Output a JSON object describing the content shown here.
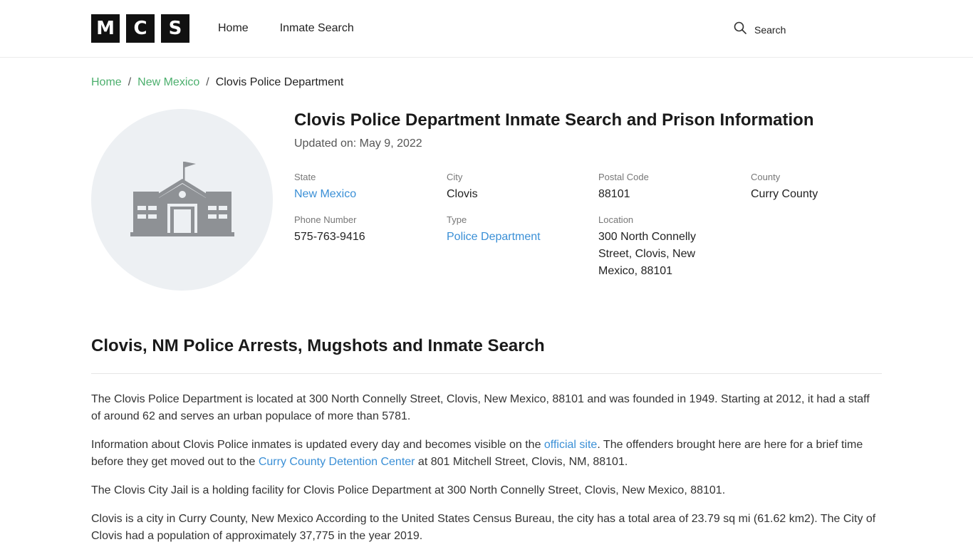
{
  "header": {
    "logo_letters": [
      "M",
      "C",
      "S"
    ],
    "nav": [
      "Home",
      "Inmate Search"
    ],
    "search_label": "Search"
  },
  "breadcrumb": {
    "items": [
      "Home",
      "New Mexico"
    ],
    "current": "Clovis Police Department",
    "separator": "/"
  },
  "facility": {
    "icon": "building-icon",
    "title": "Clovis Police Department Inmate Search and Prison Information",
    "updated": "Updated on: May 9, 2022",
    "fields": {
      "state": {
        "label": "State",
        "value": "New Mexico"
      },
      "city": {
        "label": "City",
        "value": "Clovis"
      },
      "postal": {
        "label": "Postal Code",
        "value": "88101"
      },
      "county": {
        "label": "County",
        "value": "Curry County"
      },
      "phone": {
        "label": "Phone Number",
        "value": "575-763-9416"
      },
      "type": {
        "label": "Type",
        "value": "Police Department"
      },
      "location": {
        "label": "Location",
        "value": "300 North Connelly Street, Clovis, New Mexico, 88101"
      }
    }
  },
  "section": {
    "heading": "Clovis, NM Police Arrests, Mugshots and Inmate Search",
    "p1": "The Clovis Police Department is located at 300 North Connelly Street, Clovis, New Mexico, 88101 and was founded in 1949. Starting at 2012, it had a staff of around 62 and serves an urban populace of more than 5781.",
    "p2_a": "Information about Clovis Police inmates is updated every day and becomes visible on the ",
    "p2_link1": "official site",
    "p2_b": ". The offenders brought here are here for a brief time before they get moved out to the ",
    "p2_link2": "Curry County Detention Center",
    "p2_c": " at 801 Mitchell Street, Clovis, NM, 88101.",
    "p3": "The Clovis City Jail is a holding facility for Clovis Police Department at 300 North Connelly Street, Clovis, New Mexico, 88101.",
    "p4": "Clovis is a city in Curry County, New Mexico According to the United States Census Bureau, the city has a total area of 23.79 sq mi (61.62 km2). The City of Clovis had a population of approximately 37,775 in the year 2019."
  },
  "colors": {
    "link": "#3a8fd6",
    "breadcrumb_link": "#4caf6d",
    "logo_bg": "#111111",
    "avatar_bg": "#edf0f3"
  }
}
